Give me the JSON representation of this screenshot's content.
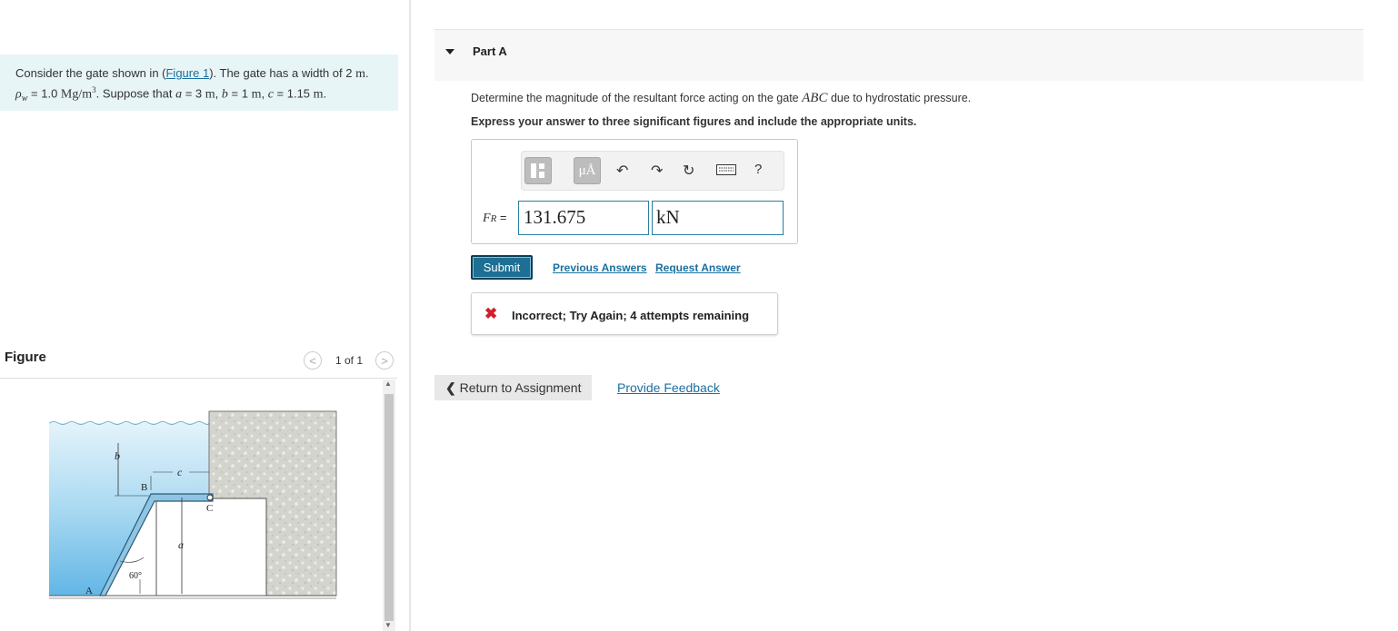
{
  "problem": {
    "line1_prefix": "Consider the gate shown in (",
    "figure_link": "Figure 1",
    "line1_suffix": "). The gate has a width of 2 ",
    "width_unit": "m",
    "line1_end": ".",
    "rho_symbol": "ρ",
    "rho_sub": "w",
    "rho_eq": " = 1.0 ",
    "rho_unit": "Mg/m",
    "rho_exp": "3",
    "suppose": ". Suppose that ",
    "a_var": "a",
    "a_eq": " = 3 ",
    "a_unit": "m",
    "b_var": "b",
    "b_eq": " = 1 ",
    "b_unit": "m",
    "c_var": "c",
    "c_eq": " = 1.15 ",
    "c_unit": "m",
    "comma": ", ",
    "period": "."
  },
  "figure": {
    "title": "Figure",
    "pager": "1 of 1",
    "prev": "<",
    "next": ">",
    "labels": {
      "b": "b",
      "c": "c",
      "B": "B",
      "C": "C",
      "a": "a",
      "A": "A",
      "angle": "60°"
    }
  },
  "part": {
    "title": "Part A",
    "question_prefix": "Determine the magnitude of the resultant force acting on the gate ",
    "question_gate": "ABC",
    "question_suffix": " due to hydrostatic pressure.",
    "instruction": "Express your answer to three significant figures and include the appropriate units."
  },
  "answer": {
    "label_var": "F",
    "label_sub": "R",
    "label_eq": " =",
    "value": "131.675",
    "unit": "kN",
    "toolbar": {
      "mu_label": "μÅ",
      "help": "?"
    }
  },
  "buttons": {
    "submit": "Submit",
    "previous_answers": "Previous Answers",
    "request_answer": "Request Answer",
    "return": "Return to Assignment",
    "provide_feedback": "Provide Feedback"
  },
  "feedback": {
    "mark": "✖",
    "text": "Incorrect; Try Again; 4 attempts remaining"
  },
  "colors": {
    "accent": "#1d6f93",
    "error": "#d0202e",
    "link": "#1a6fa0"
  }
}
